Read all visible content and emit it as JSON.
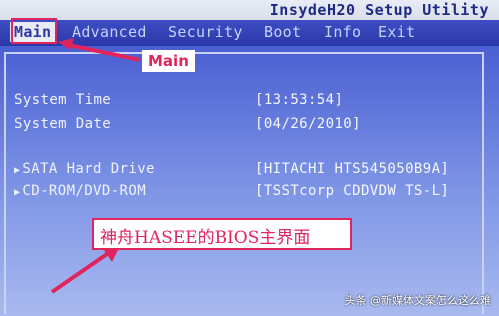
{
  "bios": {
    "title": "InsydeH20 Setup Utility",
    "menu": [
      {
        "label": "Main"
      },
      {
        "label": "Advanced"
      },
      {
        "label": "Security"
      },
      {
        "label": "Boot"
      },
      {
        "label": "Info"
      },
      {
        "label": "Exit"
      }
    ],
    "fields": {
      "system_time_label": "System Time",
      "system_time_value": "[13:53:54]",
      "system_date_label": "System Date",
      "system_date_value": "[04/26/2010]",
      "sata_label": "SATA Hard Drive",
      "sata_value": "[HITACHI HTS545050B9A]",
      "cdrom_label": "CD-ROM/DVD-ROM",
      "cdrom_value": "[TSSTcorp CDDVDW TS-L]"
    }
  },
  "annotations": {
    "main_callout": "Main",
    "caption": "神舟HASEE的BIOS主界面"
  },
  "watermark": "头条 @新媒体文案怎么这么难",
  "colors": {
    "annotation": "#e0245e",
    "menu_bar": "#3442b8",
    "panel": "#5a6fd8"
  }
}
